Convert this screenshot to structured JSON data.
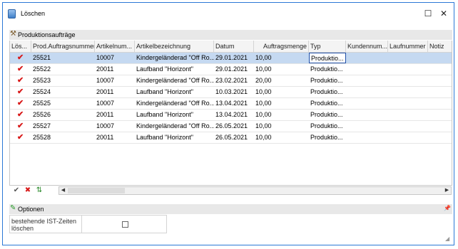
{
  "window": {
    "title": "Löschen",
    "maximize_icon": "☐",
    "close_icon": "✕"
  },
  "panel": {
    "title": "Produktionsaufträge",
    "icon": "hammer-icon"
  },
  "columns": [
    "Lös...",
    "Prod.Auftragsnummer",
    "Artikelnum...",
    "Artikelbezeichnung",
    "Datum",
    "Auftragsmenge",
    "Typ",
    "Kundennum...",
    "Laufnummer",
    "Notiz"
  ],
  "rows": [
    {
      "checked": "✔",
      "nr": "25521",
      "art": "10007",
      "bez": "Kindergeländerad \"Off Ro...",
      "datum": "29.01.2021",
      "menge": "10,00",
      "typ": "Produktio..."
    },
    {
      "checked": "✔",
      "nr": "25522",
      "art": "20011",
      "bez": "Laufband \"Horizont\"",
      "datum": "29.01.2021",
      "menge": "10,00",
      "typ": "Produktio..."
    },
    {
      "checked": "✔",
      "nr": "25523",
      "art": "10007",
      "bez": "Kindergeländerad \"Off Ro...",
      "datum": "23.02.2021",
      "menge": "20,00",
      "typ": "Produktio..."
    },
    {
      "checked": "✔",
      "nr": "25524",
      "art": "20011",
      "bez": "Laufband \"Horizont\"",
      "datum": "10.03.2021",
      "menge": "10,00",
      "typ": "Produktio..."
    },
    {
      "checked": "✔",
      "nr": "25525",
      "art": "10007",
      "bez": "Kindergeländerad \"Off Ro...",
      "datum": "13.04.2021",
      "menge": "10,00",
      "typ": "Produktio..."
    },
    {
      "checked": "✔",
      "nr": "25526",
      "art": "20011",
      "bez": "Laufband \"Horizont\"",
      "datum": "13.04.2021",
      "menge": "10,00",
      "typ": "Produktio..."
    },
    {
      "checked": "✔",
      "nr": "25527",
      "art": "10007",
      "bez": "Kindergeländerad \"Off Ro...",
      "datum": "26.05.2021",
      "menge": "10,00",
      "typ": "Produktio..."
    },
    {
      "checked": "✔",
      "nr": "25528",
      "art": "20011",
      "bez": "Laufband \"Horizont\"",
      "datum": "26.05.2021",
      "menge": "10,00",
      "typ": "Produktio..."
    }
  ],
  "toolbar": {
    "select_all_icon": "✔",
    "delete_icon": "✖",
    "sort_icon": "⇅",
    "left_arrow": "◀",
    "right_arrow": "▶"
  },
  "options": {
    "title": "Optionen",
    "pin_icon": "📌",
    "field_label": "bestehende IST-Zeiten löschen"
  },
  "colors": {
    "selected_row": "#c5d9f1",
    "check": "#d81818",
    "window_border": "#2b78d6"
  }
}
